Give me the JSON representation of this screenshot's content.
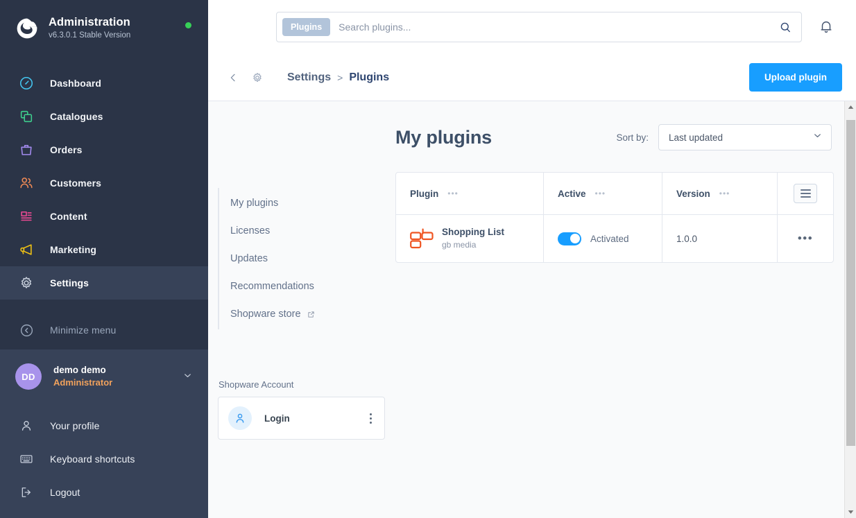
{
  "sidebar": {
    "brand": {
      "title": "Administration",
      "version": "v6.3.0.1 Stable Version",
      "status_icon": "status-dot-online",
      "status_color": "#37d058"
    },
    "nav": [
      {
        "label": "Dashboard",
        "icon": "dashboard-icon",
        "color": "#44c6f0",
        "active": false
      },
      {
        "label": "Catalogues",
        "icon": "catalogues-icon",
        "color": "#3ecf8e",
        "active": false
      },
      {
        "label": "Orders",
        "icon": "orders-icon",
        "color": "#a48bf0",
        "active": false
      },
      {
        "label": "Customers",
        "icon": "customers-icon",
        "color": "#f08a55",
        "active": false
      },
      {
        "label": "Content",
        "icon": "content-icon",
        "color": "#ef4a96",
        "active": false
      },
      {
        "label": "Marketing",
        "icon": "marketing-icon",
        "color": "#f2c313",
        "active": false
      },
      {
        "label": "Settings",
        "icon": "gear-icon",
        "color": "#c3cbd8",
        "active": true
      }
    ],
    "minimize": {
      "label": "Minimize menu",
      "icon": "minimize-icon"
    },
    "user": {
      "initials": "DD",
      "name": "demo demo",
      "role": "Administrator",
      "chevron": "chevron-down-icon"
    },
    "user_menu": [
      {
        "label": "Your profile",
        "icon": "user-icon"
      },
      {
        "label": "Keyboard shortcuts",
        "icon": "keyboard-icon"
      },
      {
        "label": "Logout",
        "icon": "logout-icon"
      }
    ]
  },
  "topbar": {
    "search": {
      "tag": "Plugins",
      "value": "",
      "placeholder": "Search plugins...",
      "icon": "search-icon"
    },
    "bell": "bell-icon"
  },
  "smartbar": {
    "back_icon": "chevron-left-icon",
    "gear_icon": "gear-icon",
    "breadcrumb": {
      "parent": "Settings",
      "separator": ">",
      "current": "Plugins"
    },
    "upload_button": "Upload plugin",
    "accent_color": "#189eff"
  },
  "side_menu": {
    "items": [
      {
        "label": "My plugins",
        "external": false
      },
      {
        "label": "Licenses",
        "external": false
      },
      {
        "label": "Updates",
        "external": false
      },
      {
        "label": "Recommendations",
        "external": false
      },
      {
        "label": "Shopware store",
        "external": true,
        "icon": "external-link-icon"
      }
    ],
    "account_label": "Shopware Account",
    "account_card": {
      "name": "Login",
      "avatar_icon": "user-avatar-icon",
      "menu_icon": "kebab-menu-icon"
    }
  },
  "plugins": {
    "title": "My plugins",
    "sort": {
      "label": "Sort by:",
      "value": "Last updated",
      "chevron": "chevron-down-icon"
    },
    "table": {
      "columns": [
        {
          "label": "Plugin",
          "dots": "•••"
        },
        {
          "label": "Active",
          "dots": "•••"
        },
        {
          "label": "Version",
          "dots": "•••"
        }
      ],
      "settings_icon": "table-settings-icon",
      "rows": [
        {
          "icon": "gb-media-logo-icon",
          "name": "Shopping List",
          "vendor": "gb media",
          "active": true,
          "active_label": "Activated",
          "version": "1.0.0",
          "actions": "•••"
        }
      ]
    }
  },
  "scrollbar": {
    "up_icon": "scroll-up-icon",
    "down_icon": "scroll-down-icon"
  }
}
